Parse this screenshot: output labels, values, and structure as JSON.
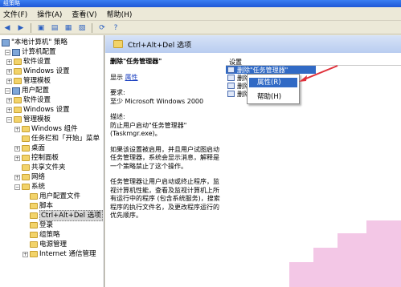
{
  "window": {
    "title": "组策略"
  },
  "menu": {
    "items": [
      "文件(F)",
      "操作(A)",
      "查看(V)",
      "帮助(H)"
    ]
  },
  "toolbar": {
    "buttons": [
      "back-icon",
      "forward-icon",
      "up-icon",
      "show-hide-tree-icon",
      "properties-icon",
      "export-icon",
      "refresh-icon",
      "help-icon"
    ]
  },
  "tree": {
    "items": [
      {
        "label": "\"本地计算机\" 策略",
        "icon": "computer-icon"
      },
      {
        "label": "计算机配置",
        "icon": "computer-icon"
      },
      {
        "label": "软件设置",
        "icon": "folder-icon"
      },
      {
        "label": "Windows 设置",
        "icon": "folder-icon"
      },
      {
        "label": "管理模板",
        "icon": "folder-icon"
      },
      {
        "label": "用户配置",
        "icon": "user-icon"
      },
      {
        "label": "软件设置",
        "icon": "folder-icon"
      },
      {
        "label": "Windows 设置",
        "icon": "folder-icon"
      },
      {
        "label": "管理模板",
        "icon": "folder-icon"
      },
      {
        "label": "Windows 组件",
        "icon": "folder-icon"
      },
      {
        "label": "任务栏和「开始」菜单",
        "icon": "folder-icon"
      },
      {
        "label": "桌面",
        "icon": "folder-icon"
      },
      {
        "label": "控制面板",
        "icon": "folder-icon"
      },
      {
        "label": "共享文件夹",
        "icon": "folder-icon"
      },
      {
        "label": "网络",
        "icon": "folder-icon"
      },
      {
        "label": "系统",
        "icon": "folder-icon"
      },
      {
        "label": "用户配置文件",
        "icon": "folder-icon"
      },
      {
        "label": "脚本",
        "icon": "folder-icon"
      },
      {
        "label": "Ctrl+Alt+Del 选项",
        "icon": "folder-icon"
      },
      {
        "label": "登录",
        "icon": "folder-icon"
      },
      {
        "label": "组策略",
        "icon": "folder-icon"
      },
      {
        "label": "电源管理",
        "icon": "folder-icon"
      },
      {
        "label": "Internet 通信管理",
        "icon": "folder-icon"
      }
    ]
  },
  "right": {
    "header": "Ctrl+Alt+Del 选项",
    "desc": {
      "title": "删除\"任务管理器\"",
      "display_prefix": "显示",
      "display_link": "属性",
      "requirement_label": "要求:",
      "requirement_value": "至少 Microsoft Windows 2000",
      "description_label": "描述:",
      "description_p1": "防止用户启动\"任务管理器\" (Taskmgr.exe)。",
      "description_p2": "如果该设置被启用，并且用户试图启动任务管理器，系统会显示消息，解释是一个策略禁止了这个操作。",
      "description_p3": "任务管理器让用户启动或终止程序，监视计算机性能，查看及监视计算机上所有运行中的程序 (包含系统服务)，搜索程序的执行文件名，及更改程序运行的优先顺序。"
    },
    "settings": {
      "column_header": "设置",
      "rows": [
        "删除\"任务管理器\"",
        "删除",
        "删除",
        "删除"
      ]
    }
  },
  "context_menu": {
    "items": [
      "属性(R)",
      "帮助(H)"
    ]
  },
  "colors": {
    "selection": "#316ac5",
    "arrow": "#e0303a",
    "titlebar": "#1f58d6"
  }
}
